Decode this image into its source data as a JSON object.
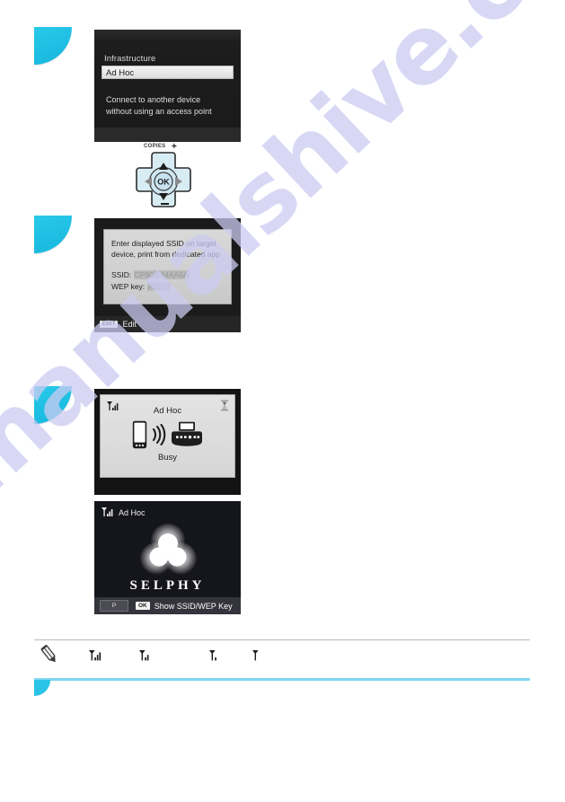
{
  "watermark": {
    "text": "manualshive.com"
  },
  "steps": [
    {
      "id": "step-1",
      "marker": "quarter-circle"
    },
    {
      "id": "step-2",
      "marker": "quarter-circle"
    },
    {
      "id": "step-3",
      "marker": "quarter-circle"
    }
  ],
  "panel1": {
    "name": "connection-method-screen",
    "option_unselected": "Infrastructure",
    "option_selected": "Ad Hoc",
    "description": "Connect to another device\nwithout using an access point"
  },
  "navpad": {
    "copies_label": "COPIES",
    "plus": "+",
    "minus": "–",
    "ok_label": "OK",
    "up_arrow": "▲",
    "down_arrow": "▼",
    "left_arrow": "◀",
    "right_arrow": "▶"
  },
  "panel2": {
    "name": "ssid-wep-screen",
    "message": "Enter displayed SSID on target device, print from dedicated app",
    "ssid_label": "SSID:",
    "ssid_value": "CP900-44AA5A",
    "wep_label": "WEP key:",
    "wep_value": "A8123",
    "edit_key": "EDIT",
    "edit_label": "Edit"
  },
  "panel3": {
    "name": "adhoc-busy-screen",
    "title": "Ad Hoc",
    "status": "Busy",
    "signal_icon": "signal-strength-icon",
    "hourglass_icon": "hourglass-icon",
    "device_icon": "smartphone-icon",
    "wireless_icon": "wireless-waves-icon",
    "printer_icon": "printer-icon"
  },
  "panel4": {
    "name": "selphy-splash-screen",
    "status": "Ad Hoc",
    "signal_icon": "signal-strength-icon",
    "wordmark": "SELPHY",
    "p_button": "P",
    "ok_button": "OK",
    "hint": "Show SSID/WEP Key"
  },
  "note": {
    "pencil_icon": "pencil-note-icon",
    "signal_levels": [
      {
        "id": "signal-strong",
        "bars": 3
      },
      {
        "id": "signal-medium",
        "bars": 2
      },
      {
        "id": "signal-weak",
        "bars": 1
      },
      {
        "id": "signal-none",
        "bars": 0
      }
    ]
  },
  "colors": {
    "accent_cyan": "#29c4e6",
    "rule_cyan": "#7fd8ee",
    "lcd_dark": "#1d1d1d",
    "lcd_light": "#d9d9d9",
    "watermark": "#ccccf2"
  }
}
